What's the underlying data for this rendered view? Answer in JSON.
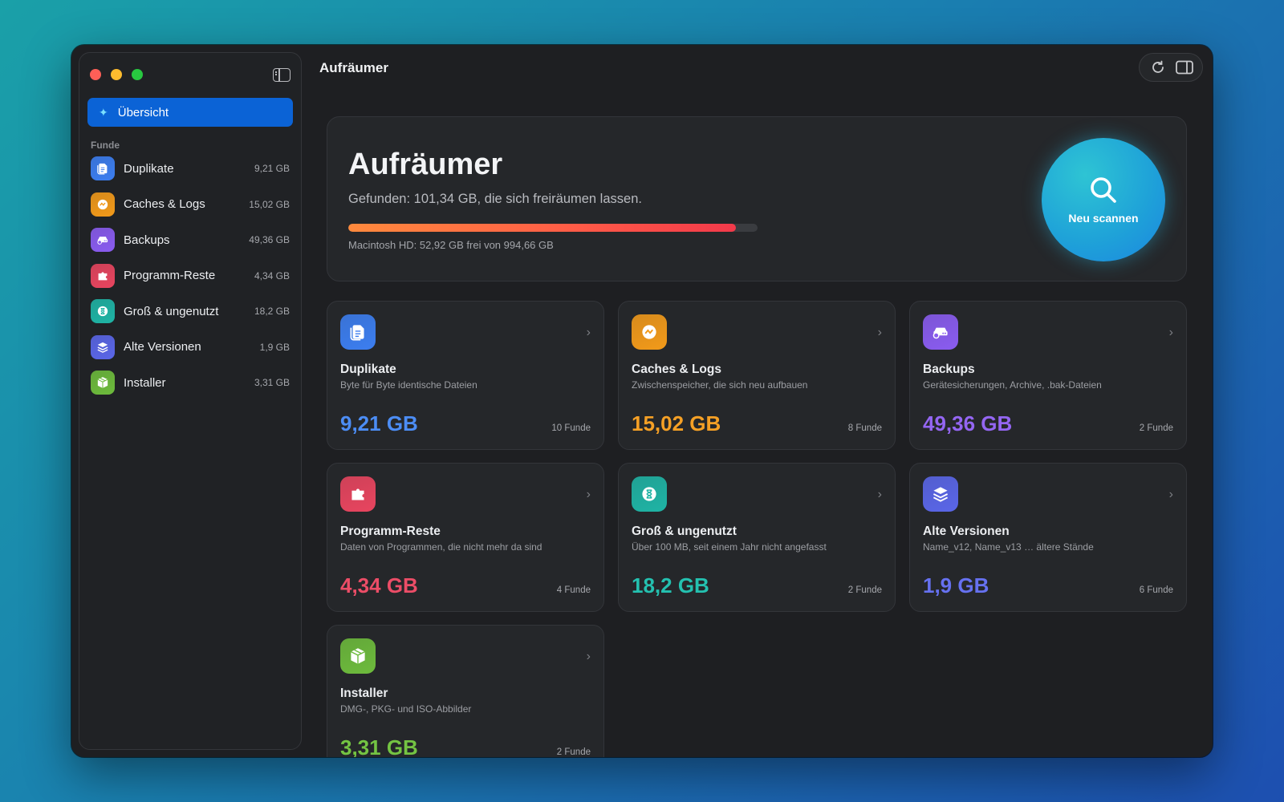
{
  "window": {
    "title": "Aufräumer"
  },
  "sidebar": {
    "overview_label": "Übersicht",
    "section_label": "Funde",
    "items": [
      {
        "label": "Duplikate",
        "size": "9,21 GB",
        "icon": "documents-icon",
        "color": "#3c7ef0"
      },
      {
        "label": "Caches & Logs",
        "size": "15,02 GB",
        "icon": "gauge-icon",
        "color": "#f29a1a"
      },
      {
        "label": "Backups",
        "size": "49,36 GB",
        "icon": "drive-backup-icon",
        "color": "#8a5cf0"
      },
      {
        "label": "Programm-Reste",
        "size": "4,34 GB",
        "icon": "puzzle-icon",
        "color": "#e8455f"
      },
      {
        "label": "Groß & ungenutzt",
        "size": "18,2 GB",
        "icon": "hourglass-icon",
        "color": "#1fb4a5"
      },
      {
        "label": "Alte Versionen",
        "size": "1,9 GB",
        "icon": "layers-icon",
        "color": "#5a66e8"
      },
      {
        "label": "Installer",
        "size": "3,31 GB",
        "icon": "package-icon",
        "color": "#6dbb3c"
      }
    ]
  },
  "hero": {
    "title": "Aufräumer",
    "subtitle": "Gefunden: 101,34 GB, die sich freiräumen lassen.",
    "disk_text": "Macintosh HD: 52,92 GB frei von 994,66 GB",
    "progress_fraction": 0.947,
    "scan_label": "Neu scannen"
  },
  "cards": [
    {
      "title": "Duplikate",
      "description": "Byte für Byte identische Dateien",
      "size": "9,21 GB",
      "count": "10 Funde",
      "icon": "documents-icon",
      "color": "#3c7ef0",
      "text_color": "#4c8df5"
    },
    {
      "title": "Caches & Logs",
      "description": "Zwischenspeicher, die sich neu aufbauen",
      "size": "15,02 GB",
      "count": "8 Funde",
      "icon": "gauge-icon",
      "color": "#f29a1a",
      "text_color": "#f5a025"
    },
    {
      "title": "Backups",
      "description": "Gerätesicherungen, Archive, .bak-Dateien",
      "size": "49,36 GB",
      "count": "2 Funde",
      "icon": "drive-backup-icon",
      "color": "#8a5cf0",
      "text_color": "#9466f2"
    },
    {
      "title": "Programm-Reste",
      "description": "Daten von Programmen, die nicht mehr da sind",
      "size": "4,34 GB",
      "count": "4 Funde",
      "icon": "puzzle-icon",
      "color": "#e8455f",
      "text_color": "#ec4d67"
    },
    {
      "title": "Groß & ungenutzt",
      "description": "Über 100 MB, seit einem Jahr nicht angefasst",
      "size": "18,2 GB",
      "count": "2 Funde",
      "icon": "hourglass-icon",
      "color": "#1fb4a5",
      "text_color": "#24c1b0"
    },
    {
      "title": "Alte Versionen",
      "description": "Name_v12, Name_v13 … ältere Stände",
      "size": "1,9 GB",
      "count": "6 Funde",
      "icon": "layers-icon",
      "color": "#5a66e8",
      "text_color": "#6671f0"
    },
    {
      "title": "Installer",
      "description": "DMG-, PKG- und ISO-Abbilder",
      "size": "3,31 GB",
      "count": "2 Funde",
      "icon": "package-icon",
      "color": "#6dbb3c",
      "text_color": "#74c443"
    }
  ]
}
